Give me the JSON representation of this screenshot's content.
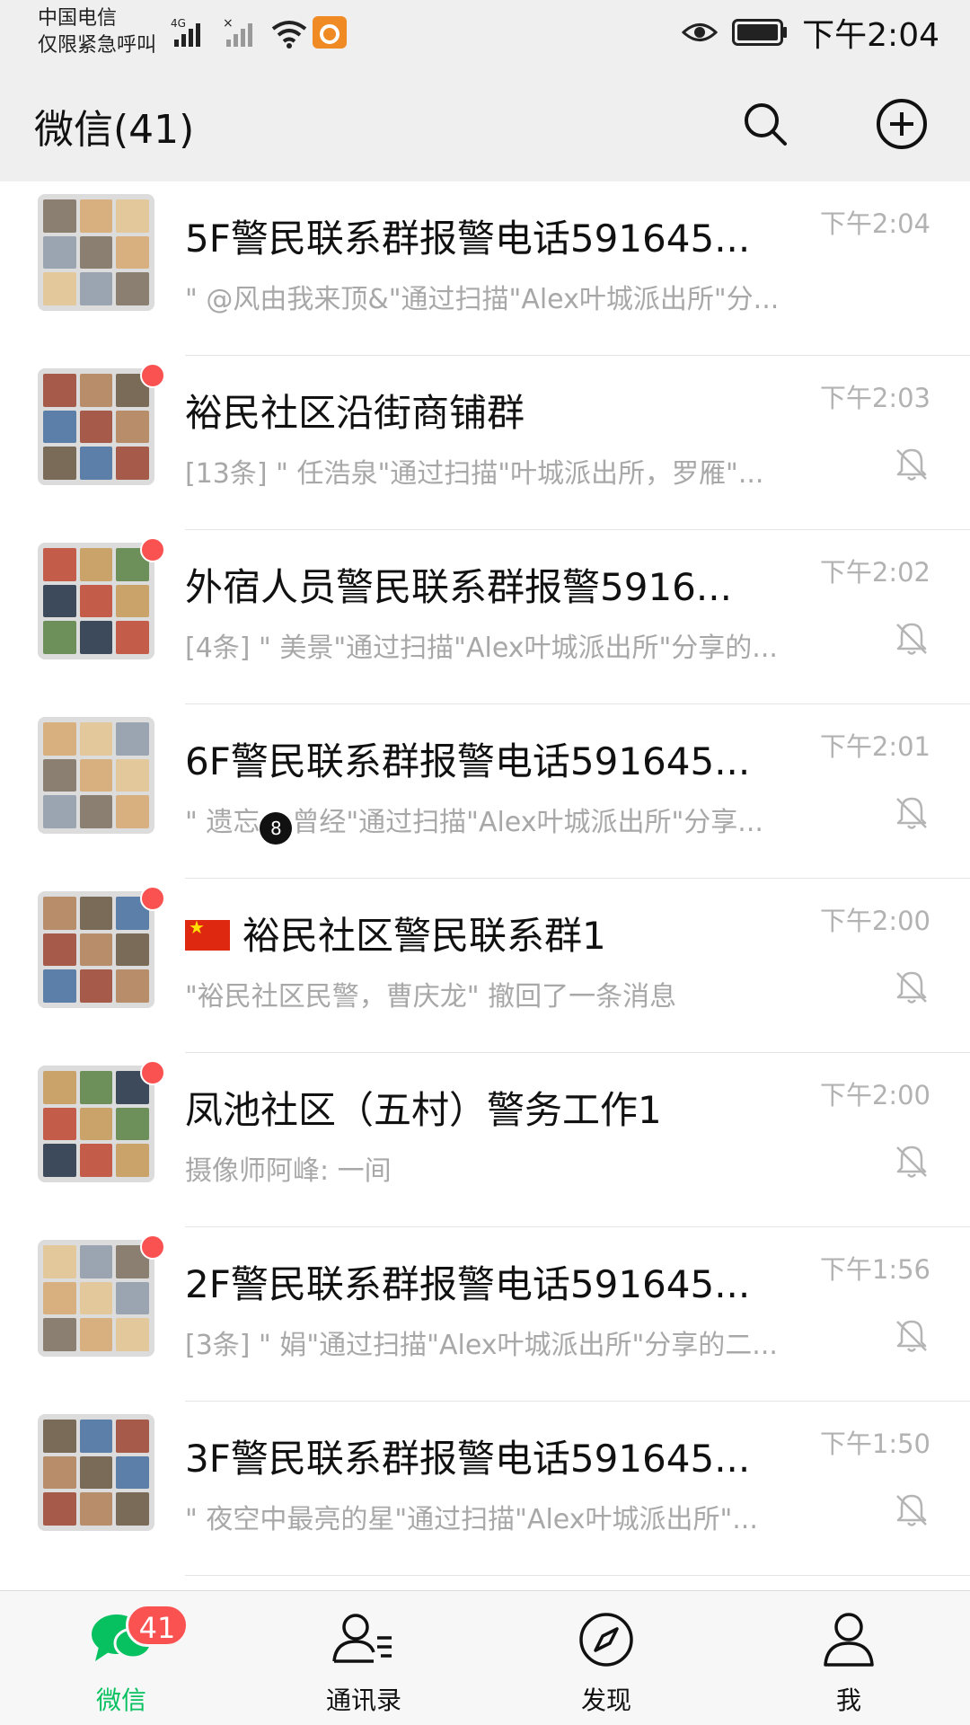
{
  "status_bar": {
    "carrier_line1": "中国电信",
    "carrier_line2": "仅限紧急呼叫",
    "network": "4G",
    "time": "下午2:04"
  },
  "header": {
    "title": "微信(41)",
    "search_icon": "search-icon",
    "add_icon": "plus-circle-icon"
  },
  "chats": [
    {
      "title": "5F警民联系群报警电话591645...",
      "time": "下午2:04",
      "preview": "\" @风由我来顶&\"通过扫描\"Alex叶城派出所\"分...",
      "unread_dot": false,
      "muted": false,
      "flag": false
    },
    {
      "title": "裕民社区沿街商铺群",
      "time": "下午2:03",
      "preview": "[13条] \" 任浩泉\"通过扫描\"叶城派出所，罗雁\"...",
      "unread_dot": true,
      "muted": true,
      "flag": false
    },
    {
      "title": "外宿人员警民联系群报警5916...",
      "time": "下午2:02",
      "preview": "[4条] \" 美景\"通过扫描\"Alex叶城派出所\"分享的...",
      "unread_dot": true,
      "muted": true,
      "flag": false
    },
    {
      "title": "6F警民联系群报警电话591645...",
      "time": "下午2:01",
      "preview_before": "\" 遗忘",
      "preview_after": "曾经\"通过扫描\"Alex叶城派出所\"分享...",
      "unread_dot": false,
      "muted": true,
      "flag": false
    },
    {
      "title": "裕民社区警民联系群1",
      "time": "下午2:00",
      "preview": "\"裕民社区民警，曹庆龙\" 撤回了一条消息",
      "unread_dot": true,
      "muted": true,
      "flag": true
    },
    {
      "title": "凤池社区（五村）警务工作1",
      "time": "下午2:00",
      "preview": "摄像师阿峰: 一间",
      "unread_dot": true,
      "muted": true,
      "flag": false
    },
    {
      "title": "2F警民联系群报警电话591645...",
      "time": "下午1:56",
      "preview": "[3条] \" 娟\"通过扫描\"Alex叶城派出所\"分享的二...",
      "unread_dot": true,
      "muted": true,
      "flag": false
    },
    {
      "title": "3F警民联系群报警电话591645...",
      "time": "下午1:50",
      "preview": "\" 夜空中最亮的星\"通过扫描\"Alex叶城派出所\"...",
      "unread_dot": false,
      "muted": true,
      "flag": false
    }
  ],
  "tabbar": {
    "tabs": [
      {
        "label": "微信",
        "icon": "chat-bubbles-icon",
        "badge": "41",
        "active": true
      },
      {
        "label": "通讯录",
        "icon": "contacts-icon",
        "active": false
      },
      {
        "label": "发现",
        "icon": "compass-icon",
        "active": false
      },
      {
        "label": "我",
        "icon": "person-icon",
        "active": false
      }
    ]
  },
  "colors": {
    "accent_green": "#07c160",
    "badge_red": "#fa5151",
    "header_bg": "#efefef"
  }
}
